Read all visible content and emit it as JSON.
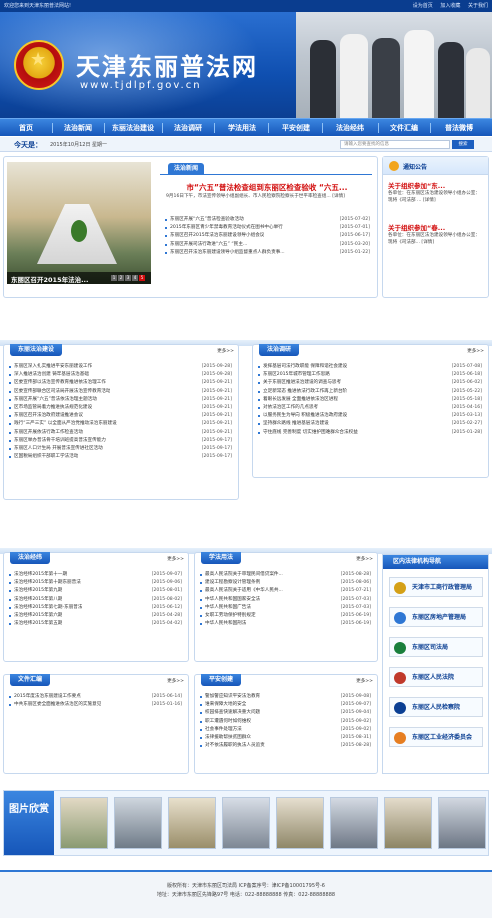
{
  "topbar": {
    "welcome": "欢迎您来到天津东丽普法网站!",
    "links": [
      "设为首页",
      "加入收藏",
      "关于我们"
    ]
  },
  "header": {
    "title": "天津东丽普法网",
    "url": "www.tjdlpf.gov.cn"
  },
  "nav": [
    "首页",
    "法治新闻",
    "东丽法治建设",
    "法治调研",
    "学法用法",
    "平安创建",
    "法治经纬",
    "文件汇编",
    "普法微博"
  ],
  "today": {
    "label": "今天是：",
    "date": "2015年10月12日  星期一",
    "search_placeholder": "请输入您要查找的信息",
    "search_button": "搜索"
  },
  "slideshow": {
    "caption": "东丽区召开2015年法治...",
    "pages": [
      "1",
      "2",
      "3",
      "4",
      "5"
    ],
    "active_page": "5"
  },
  "law_news": {
    "tab": "法治新闻",
    "headline": "市“六五”普法检查组到东丽区检查验收 “六五...",
    "summary": "9月16日下午，市法宣传领导小组副组长、市人民检察院检察长于世平率检查组...  [详情]",
    "items": [
      {
        "title": "东丽区开展“六五”普法检查验收活动",
        "date": "[2015-07-02]"
      },
      {
        "title": "2015年东丽区青少年禁毒教育活动仪式在图书中心举行",
        "date": "[2015-07-01]"
      },
      {
        "title": "东丽区召开2015年法治东丽建设领导小组会议",
        "date": "[2015-06-17]"
      },
      {
        "title": "东丽区开展司法行政进“六五” “民主...",
        "date": "[2015-03-20]"
      },
      {
        "title": "东丽区召开法治东丽建设领导小组监督重点人群负责事...",
        "date": "[2015-01-22]"
      }
    ]
  },
  "notice": {
    "title": "通知公告",
    "items": [
      {
        "title": "关于组织参加“东...",
        "body": "各单位：在东丽区法治建设领导小组办公室：现将《司法部 ... [详情]"
      },
      {
        "title": "关于组织参加“春...",
        "body": "各单位：在东丽区法治建设领导小组办公室：现将《司法部... [详情]"
      }
    ]
  },
  "more_label": "更多>>",
  "panels": {
    "construction": {
      "tab": "东丽法治建设",
      "items": [
        {
          "title": "东丽区深入扎实推进平安东丽建设工作",
          "date": "[2015-09-28]"
        },
        {
          "title": "深入推进法治创建 铸牢基层法治基础",
          "date": "[2015-09-28]"
        },
        {
          "title": "区委宣传部以法治宣传教育推进依法治理工作",
          "date": "[2015-09-21]"
        },
        {
          "title": "区委宣传部联合区司法局开展法治宣传教育活动",
          "date": "[2015-09-21]"
        },
        {
          "title": "东丽区开展“六五”普法依法治理主题活动",
          "date": "[2015-09-21]"
        },
        {
          "title": "区市场监管局着力推进执法规范化建设",
          "date": "[2015-09-21]"
        },
        {
          "title": "东丽区召开法治政府建设推进会议",
          "date": "[2015-09-21]"
        },
        {
          "title": "践行“三严三实” 以全面从严治党推动法治东丽建设",
          "date": "[2015-09-21]"
        },
        {
          "title": "东丽区开展依法行政工作检查活动",
          "date": "[2015-09-21]"
        },
        {
          "title": "东丽区举办普法骨干培训班提高普法宣传能力",
          "date": "[2015-09-17]"
        },
        {
          "title": "东丽区人口计生局 开展普法宣传进社区活动",
          "date": "[2015-09-17]"
        },
        {
          "title": "区国税局组织干部职工学法活动",
          "date": "[2015-09-17]"
        }
      ]
    },
    "research": {
      "tab": "法治调研",
      "items": [
        {
          "title": "发挥基层司法行政职能 保障和谐社会建设",
          "date": "[2015-07-08]"
        },
        {
          "title": "东丽区2015年城市管理工作思路",
          "date": "[2015-06-18]"
        },
        {
          "title": "关于东丽区推进法治建设的调查与思考",
          "date": "[2015-06-02]"
        },
        {
          "title": "立足新常态 推进依法行政工作再上新台阶",
          "date": "[2015-05-22]"
        },
        {
          "title": "着眼长远发展 全面推进依法治区进程",
          "date": "[2015-05-18]"
        },
        {
          "title": "对依法治区工作的几点思考",
          "date": "[2015-04-16]"
        },
        {
          "title": "以服务民生为导向 积极推进法治政府建设",
          "date": "[2015-03-13]"
        },
        {
          "title": "坚持群众路线 推进基层法治建设",
          "date": "[2015-02-27]"
        },
        {
          "title": "守住底线 完善制度 切实维护困难群众合法权益",
          "date": "[2015-01-28]"
        }
      ]
    },
    "jingwei": {
      "tab": "法治经纬",
      "items": [
        {
          "title": "法治经纬2015年第十一期",
          "date": "[2015-09-07]"
        },
        {
          "title": "法治经纬2015年第十期东丽普法",
          "date": "[2015-09-06]"
        },
        {
          "title": "法治经纬2015年第九期",
          "date": "[2015-08-01]"
        },
        {
          "title": "法治经纬2015年第八期",
          "date": "[2015-08-02]"
        },
        {
          "title": "法治经纬2015年第七期-东丽普法",
          "date": "[2015-06-12]"
        },
        {
          "title": "法治经纬2015年第六期",
          "date": "[2015-04-28]"
        },
        {
          "title": "法治经纬2015年第五期",
          "date": "[2015-04-02]"
        }
      ]
    },
    "xuefa": {
      "tab": "学法用法",
      "items": [
        {
          "title": "最高人民法院关于审理民间借贷案件...",
          "date": "[2015-08-28]"
        },
        {
          "title": "建设工程勘察设计管理条例",
          "date": "[2015-08-06]"
        },
        {
          "title": "最高人民法院关于适用《中华人民共...",
          "date": "[2015-07-21]"
        },
        {
          "title": "中华人民共和国国家安全法",
          "date": "[2015-07-03]"
        },
        {
          "title": "中华人民共和国广告法",
          "date": "[2015-07-03]"
        },
        {
          "title": "女职工劳动保护特别规定",
          "date": "[2015-06-19]"
        },
        {
          "title": "中华人民共和国刑法",
          "date": "[2015-06-19]"
        }
      ]
    },
    "wenjian": {
      "tab": "文件汇编",
      "items": [
        {
          "title": "2015年度法治东丽建设工作要点",
          "date": "[2015-06-14]"
        },
        {
          "title": "中共东丽区委全面推进依法治区的实施意见",
          "date": "[2015-01-16]"
        }
      ]
    },
    "pingan": {
      "tab": "平安创建",
      "items": [
        {
          "title": "警加警应知识平安法治教育",
          "date": "[2015-09-08]"
        },
        {
          "title": "谁来保障大地的安全",
          "date": "[2015-09-07]"
        },
        {
          "title": "校园排查快速解决重大问题",
          "date": "[2015-09-04]"
        },
        {
          "title": "职工遭遇何时如何维权",
          "date": "[2015-09-02]"
        },
        {
          "title": "社会事件处理方法",
          "date": "[2015-09-02]"
        },
        {
          "title": "法律援助帮扶贫困群众",
          "date": "[2015-08-31]"
        },
        {
          "title": "对不依法履职的执法人员追责",
          "date": "[2015-08-28]"
        }
      ]
    }
  },
  "link_nav": {
    "title": "区内法律机构导航",
    "items": [
      {
        "label": "天津市工商行政管理局",
        "color": "#d4a017"
      },
      {
        "label": "东丽区房地产管理局",
        "color": "#2f77d4"
      },
      {
        "label": "东丽区司法局",
        "color": "#1a7f3c"
      },
      {
        "label": "东丽区人民法院",
        "color": "#c0392b"
      },
      {
        "label": "东丽区人民检察院",
        "color": "#0b3f93"
      },
      {
        "label": "东丽区工业经济委员会",
        "color": "#e67e22"
      }
    ]
  },
  "gallery": {
    "label": "图片欣赏"
  },
  "footer": {
    "line1": "版权所有：天津市东丽区司法局  ICP备案序号：津ICP备10001795号-6",
    "line2": "地址：天津市东丽区先锋路97号 电话：022-88888888 传真：022-88888888"
  },
  "colors": {
    "brand": "#1656b9",
    "accent": "#d20d0d"
  }
}
